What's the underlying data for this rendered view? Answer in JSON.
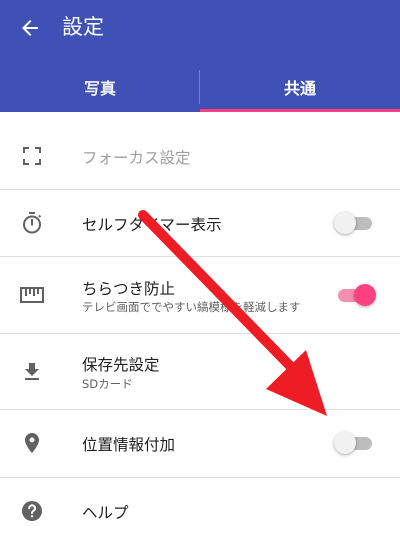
{
  "colors": {
    "primary": "#3f51b5",
    "accent": "#ff4081",
    "arrow": "#ee1c24"
  },
  "header": {
    "title": "設定",
    "back_icon": "arrow-left-icon"
  },
  "tabs": [
    {
      "label": "写真",
      "selected": false
    },
    {
      "label": "共通",
      "selected": true
    }
  ],
  "settings": {
    "focus": {
      "label": "フォーカス設定",
      "enabled": false,
      "icon": "focus-frame-icon"
    },
    "self_timer": {
      "label": "セルフタイマー表示",
      "switch_on": false,
      "icon": "timer-icon"
    },
    "flicker": {
      "label": "ちらつき防止",
      "sub": "テレビ画面ででやすい縞模様を軽減します",
      "switch_on": true,
      "icon": "ruler-icon"
    },
    "save_dest": {
      "label": "保存先設定",
      "sub": "SDカード",
      "icon": "download-icon"
    },
    "location": {
      "label": "位置情報付加",
      "switch_on": false,
      "icon": "location-pin-icon"
    },
    "help": {
      "label": "ヘルプ",
      "icon": "help-circle-icon"
    }
  },
  "annotation": {
    "icon": "red-arrow-icon"
  }
}
